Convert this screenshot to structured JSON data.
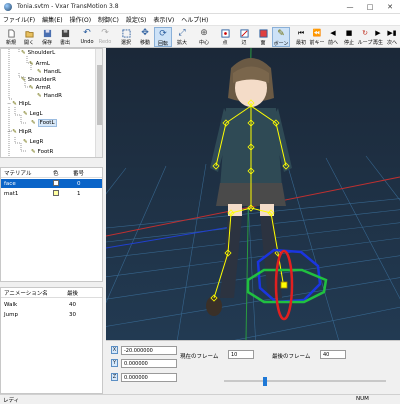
{
  "window": {
    "title": "Tonia.svtm - Vxar TransMotion 3.8"
  },
  "menu": [
    "ファイル(F)",
    "編集(E)",
    "操作(O)",
    "制御(C)",
    "設定(S)",
    "表示(V)",
    "ヘルプ(H)"
  ],
  "toolbar": {
    "new": "新規",
    "open": "開く",
    "save": "保存",
    "export": "書出",
    "undo": "Undo",
    "redo": "Redo",
    "select": "選択",
    "move": "移動",
    "rotate": "回転",
    "scale": "拡大",
    "center": "中心",
    "point": "点",
    "line": "辺",
    "face": "面",
    "bone": "ボーン",
    "first_frame": "最初",
    "prev_keyframe": "前キー",
    "prev_frame": "前へ",
    "stop": "停止",
    "loop": "ループ",
    "play": "再生",
    "next_frame": "次へ"
  },
  "tree": {
    "items": [
      {
        "label": "ShoulderL"
      },
      {
        "label": "ArmL"
      },
      {
        "label": "HandL"
      },
      {
        "label": "ShoulderR"
      },
      {
        "label": "ArmR"
      },
      {
        "label": "HandR"
      },
      {
        "label": "HipL"
      },
      {
        "label": "LegL"
      },
      {
        "label": "FootL"
      },
      {
        "label": "HipR"
      },
      {
        "label": "LegR"
      },
      {
        "label": "FootR"
      }
    ]
  },
  "materials": {
    "col_name": "マテリアル",
    "col_color": "色",
    "col_num": "番号",
    "rows": [
      {
        "name": "face",
        "num": "0",
        "color": "#ffffff"
      },
      {
        "name": "mat1",
        "num": "1",
        "color": "#ffff80"
      }
    ]
  },
  "animations": {
    "col_name": "アニメーション名",
    "col_last": "最後",
    "rows": [
      {
        "name": "Walk",
        "last": "40"
      },
      {
        "name": "Jump",
        "last": "30"
      }
    ]
  },
  "coords": {
    "x_label": "X",
    "y_label": "Y",
    "z_label": "Z",
    "x_value": "-20.000000",
    "y_value": "0.000000",
    "z_value": "0.000000"
  },
  "frames": {
    "current_label": "現在のフレーム",
    "current_value": "10",
    "last_label": "最後のフレーム",
    "last_value": "40",
    "slider_fraction": 0.25
  },
  "status": {
    "ready": "レディ",
    "num": "NUM"
  },
  "colors": {
    "selection": "#0a64c8",
    "viewport_bg": "#1c2a3a",
    "grid": "#3b6f9a",
    "bone": "#ffff00"
  }
}
